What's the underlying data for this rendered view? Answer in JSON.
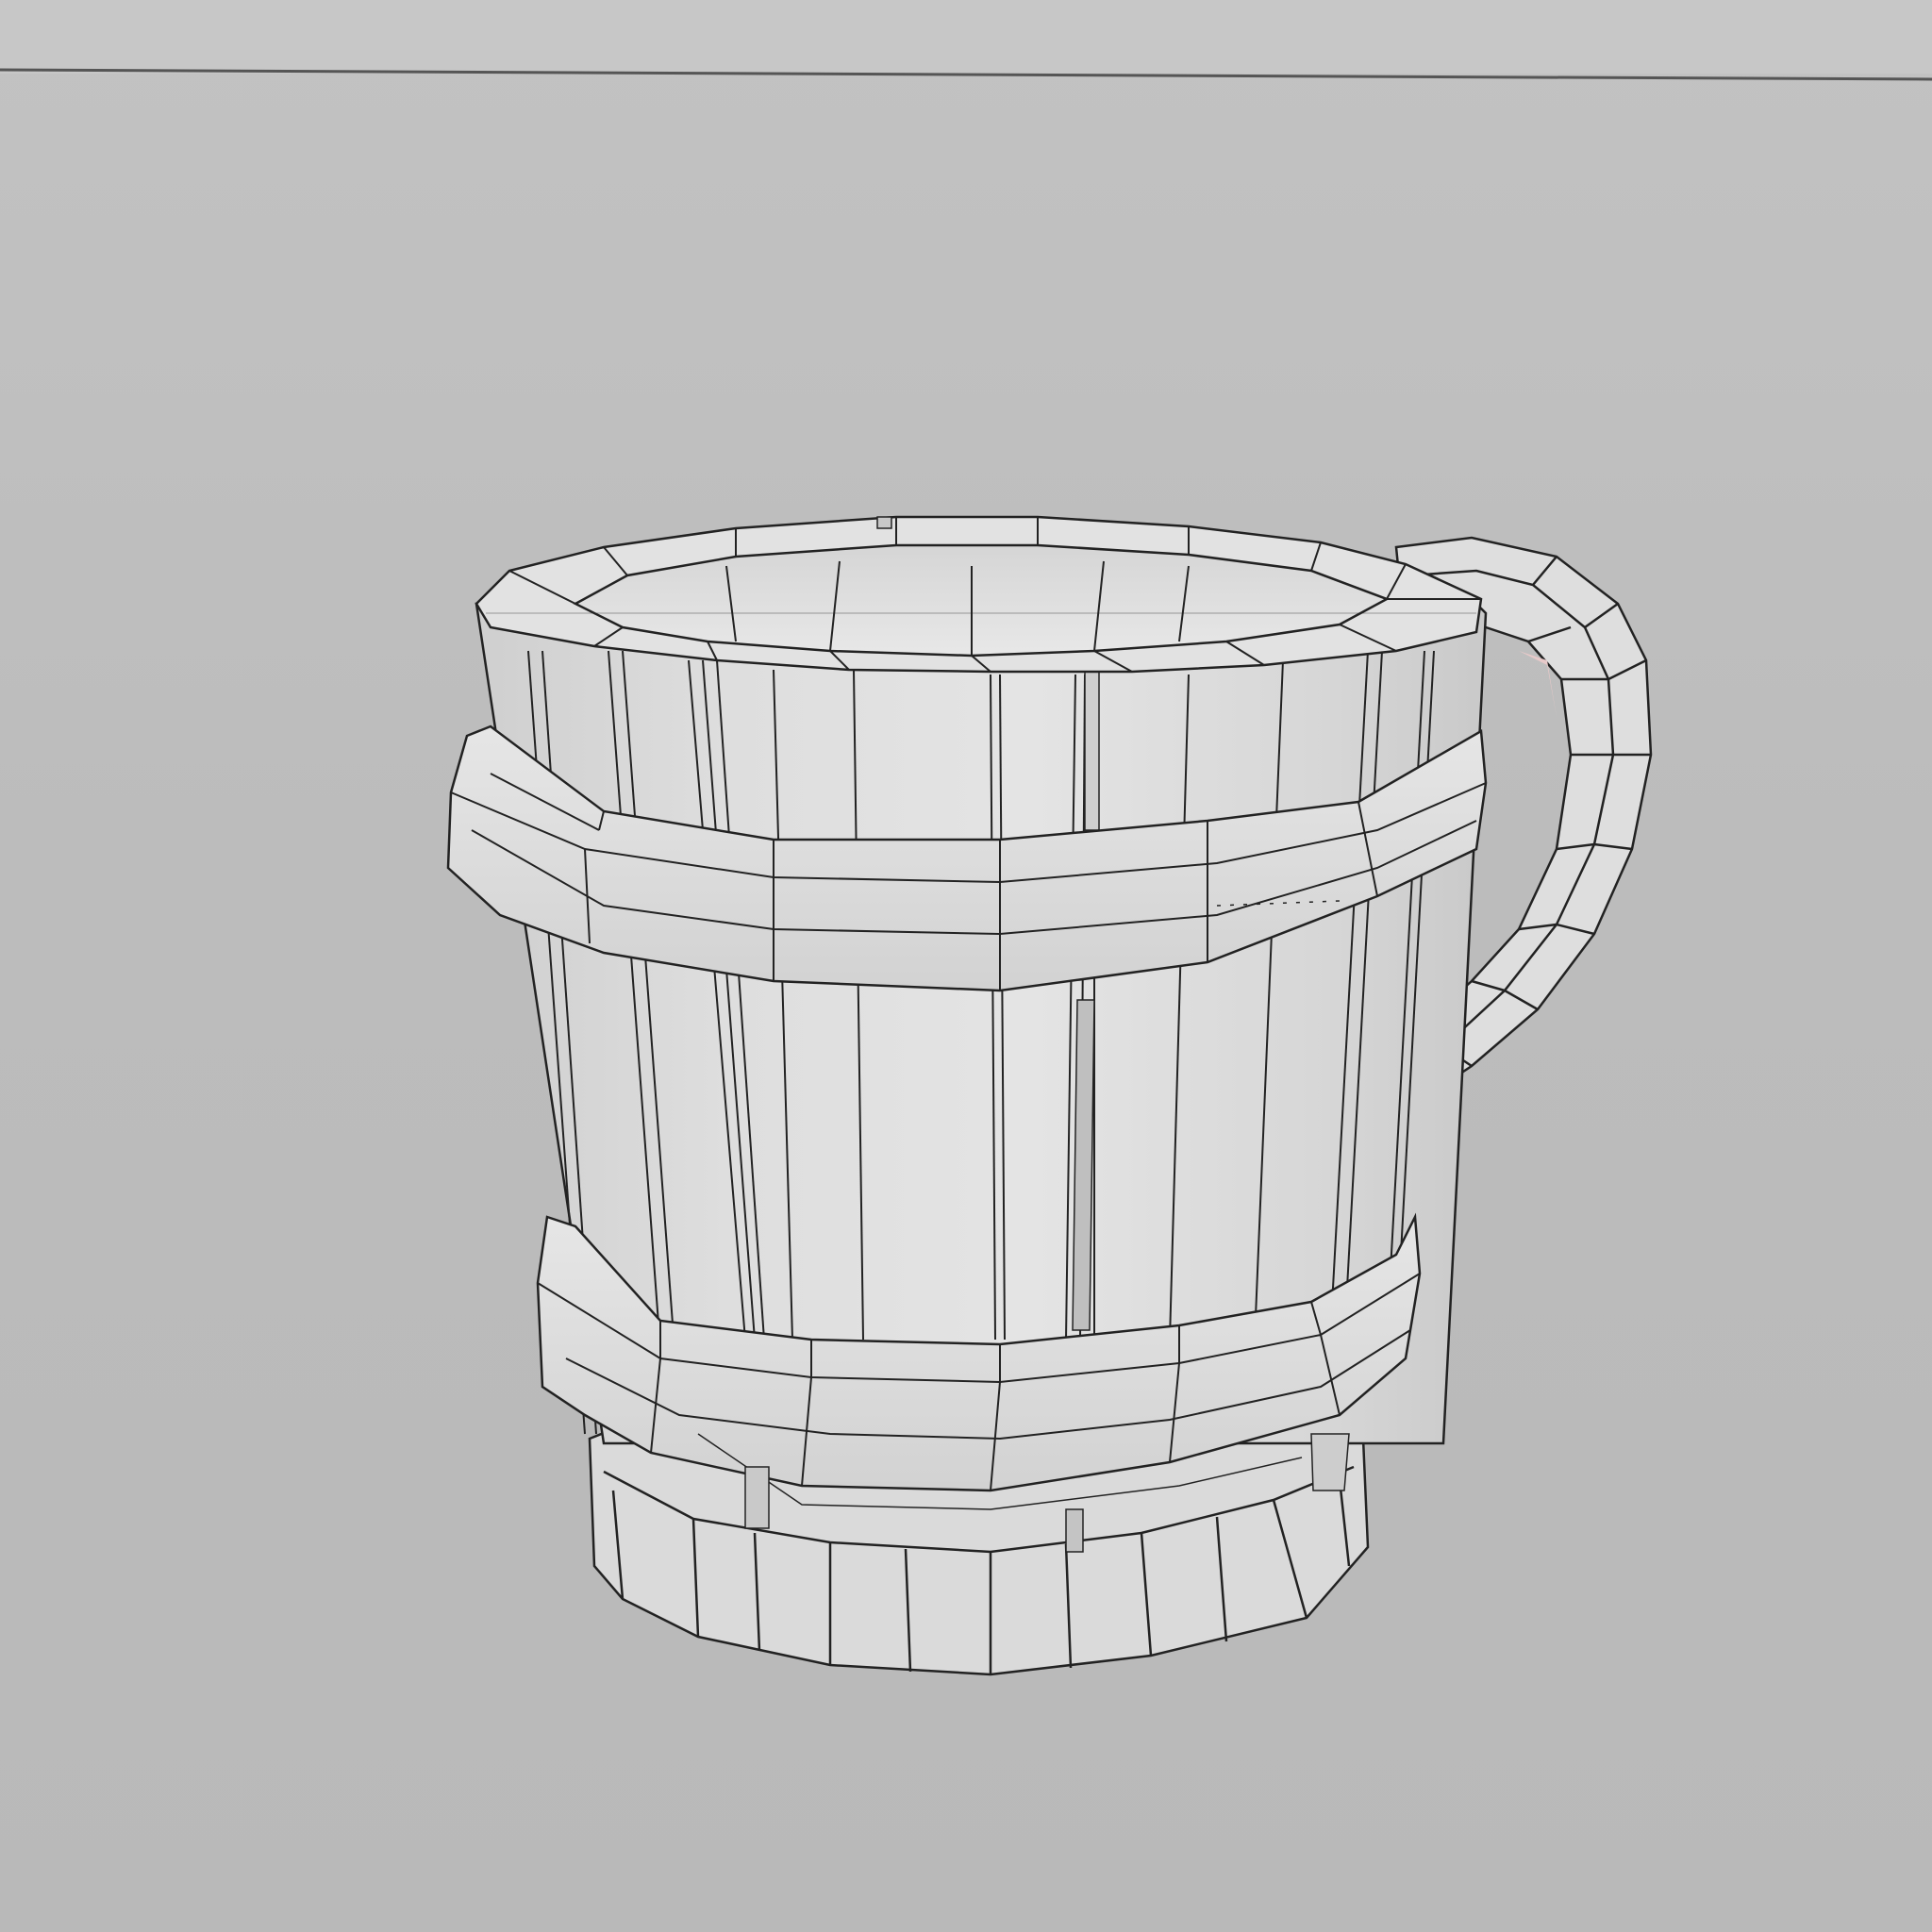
{
  "viewport": {
    "background_color": "#bdbdbd",
    "horizon_line_color": "#555555"
  },
  "model": {
    "type": "wooden-tankard",
    "render_style": "wireframe-on-shaded",
    "surface_color": "#dcdcdc",
    "wire_color": "#222222",
    "parts": [
      "rim",
      "staves",
      "upper-hoop",
      "lower-hoop",
      "base-ring",
      "handle"
    ]
  }
}
